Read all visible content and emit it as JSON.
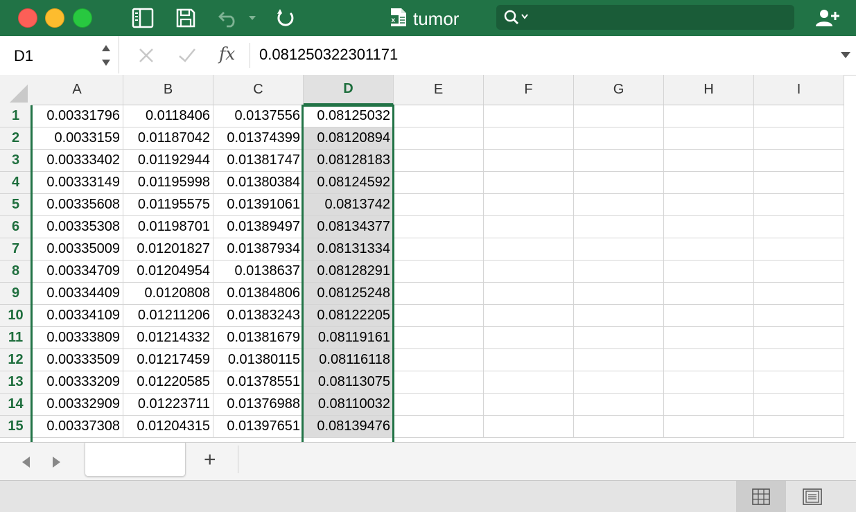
{
  "window": {
    "title": "tumor",
    "colors": {
      "titlebar": "#217346",
      "accent": "#217346",
      "row_header_text": "#1e6e3d"
    },
    "icons": [
      "sidebar-toggle-icon",
      "save-icon",
      "undo-icon",
      "undo-dropdown-icon",
      "redo-icon",
      "excel-file-icon",
      "search-icon",
      "share-user-icon"
    ]
  },
  "formula_bar": {
    "name_box": "D1",
    "fx_label": "fx",
    "formula": "0.081250322301171"
  },
  "columns": [
    "A",
    "B",
    "C",
    "D",
    "E",
    "F",
    "G",
    "H",
    "I"
  ],
  "selected_column": "D",
  "active_cell": "D1",
  "rows": [
    {
      "num": "1",
      "values": [
        "0.00331796",
        "0.0118406",
        "0.0137556",
        "0.08125032"
      ]
    },
    {
      "num": "2",
      "values": [
        "0.0033159",
        "0.01187042",
        "0.01374399",
        "0.08120894"
      ]
    },
    {
      "num": "3",
      "values": [
        "0.00333402",
        "0.01192944",
        "0.01381747",
        "0.08128183"
      ]
    },
    {
      "num": "4",
      "values": [
        "0.00333149",
        "0.01195998",
        "0.01380384",
        "0.08124592"
      ]
    },
    {
      "num": "5",
      "values": [
        "0.00335608",
        "0.01195575",
        "0.01391061",
        "0.0813742"
      ]
    },
    {
      "num": "6",
      "values": [
        "0.00335308",
        "0.01198701",
        "0.01389497",
        "0.08134377"
      ]
    },
    {
      "num": "7",
      "values": [
        "0.00335009",
        "0.01201827",
        "0.01387934",
        "0.08131334"
      ]
    },
    {
      "num": "8",
      "values": [
        "0.00334709",
        "0.01204954",
        "0.0138637",
        "0.08128291"
      ]
    },
    {
      "num": "9",
      "values": [
        "0.00334409",
        "0.0120808",
        "0.01384806",
        "0.08125248"
      ]
    },
    {
      "num": "10",
      "values": [
        "0.00334109",
        "0.01211206",
        "0.01383243",
        "0.08122205"
      ]
    },
    {
      "num": "11",
      "values": [
        "0.00333809",
        "0.01214332",
        "0.01381679",
        "0.08119161"
      ]
    },
    {
      "num": "12",
      "values": [
        "0.00333509",
        "0.01217459",
        "0.01380115",
        "0.08116118"
      ]
    },
    {
      "num": "13",
      "values": [
        "0.00333209",
        "0.01220585",
        "0.01378551",
        "0.08113075"
      ]
    },
    {
      "num": "14",
      "values": [
        "0.00332909",
        "0.01223711",
        "0.01376988",
        "0.08110032"
      ]
    },
    {
      "num": "15",
      "values": [
        "0.00337308",
        "0.01204315",
        "0.01397651",
        "0.08139476"
      ]
    }
  ],
  "sheet_bar": {
    "add_label": "+",
    "active_tab_label": ""
  },
  "status_bar": {
    "active_view": "normal"
  }
}
